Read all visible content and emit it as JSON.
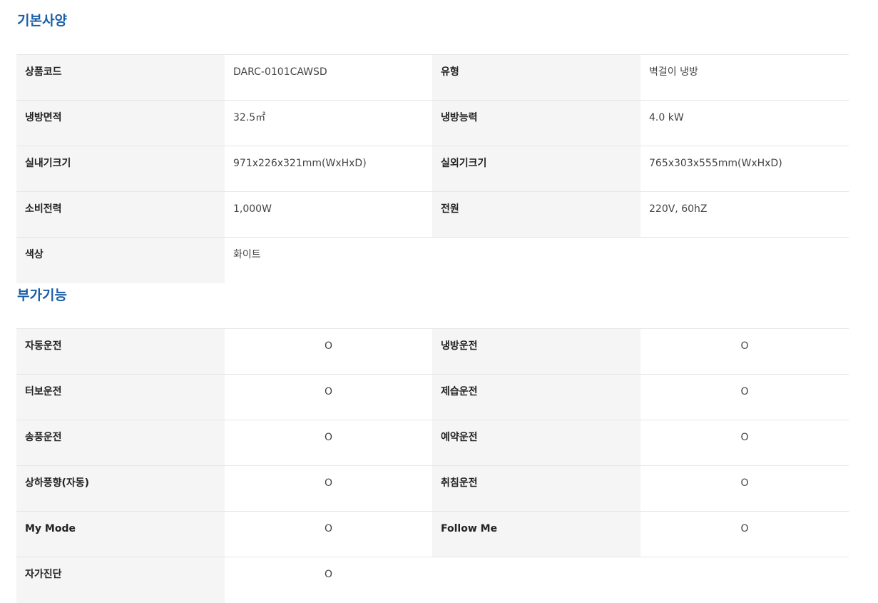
{
  "basic_spec": {
    "title": "기본사양",
    "rows": [
      [
        "상품코드",
        "DARC-0101CAWSD",
        "유형",
        "벽걸이 냉방"
      ],
      [
        "냉방면적",
        "32.5㎡",
        "냉방능력",
        "4.0 kW"
      ],
      [
        "실내기크기",
        "971x226x321mm(WxHxD)",
        "실외기크기",
        "765x303x555mm(WxHxD)"
      ],
      [
        "소비전력",
        "1,000W",
        "전원",
        "220V, 60hZ"
      ],
      [
        "색상",
        "화이트"
      ]
    ]
  },
  "extra_features": {
    "title": "부가기능",
    "rows": [
      [
        "자동운전",
        "O",
        "냉방운전",
        "O"
      ],
      [
        "터보운전",
        "O",
        "제습운전",
        "O"
      ],
      [
        "송풍운전",
        "O",
        "예약운전",
        "O"
      ],
      [
        "상하풍향(자동)",
        "O",
        "취침운전",
        "O"
      ],
      [
        "My Mode",
        "O",
        "Follow Me",
        "O"
      ],
      [
        "자가진단",
        "O"
      ]
    ]
  }
}
